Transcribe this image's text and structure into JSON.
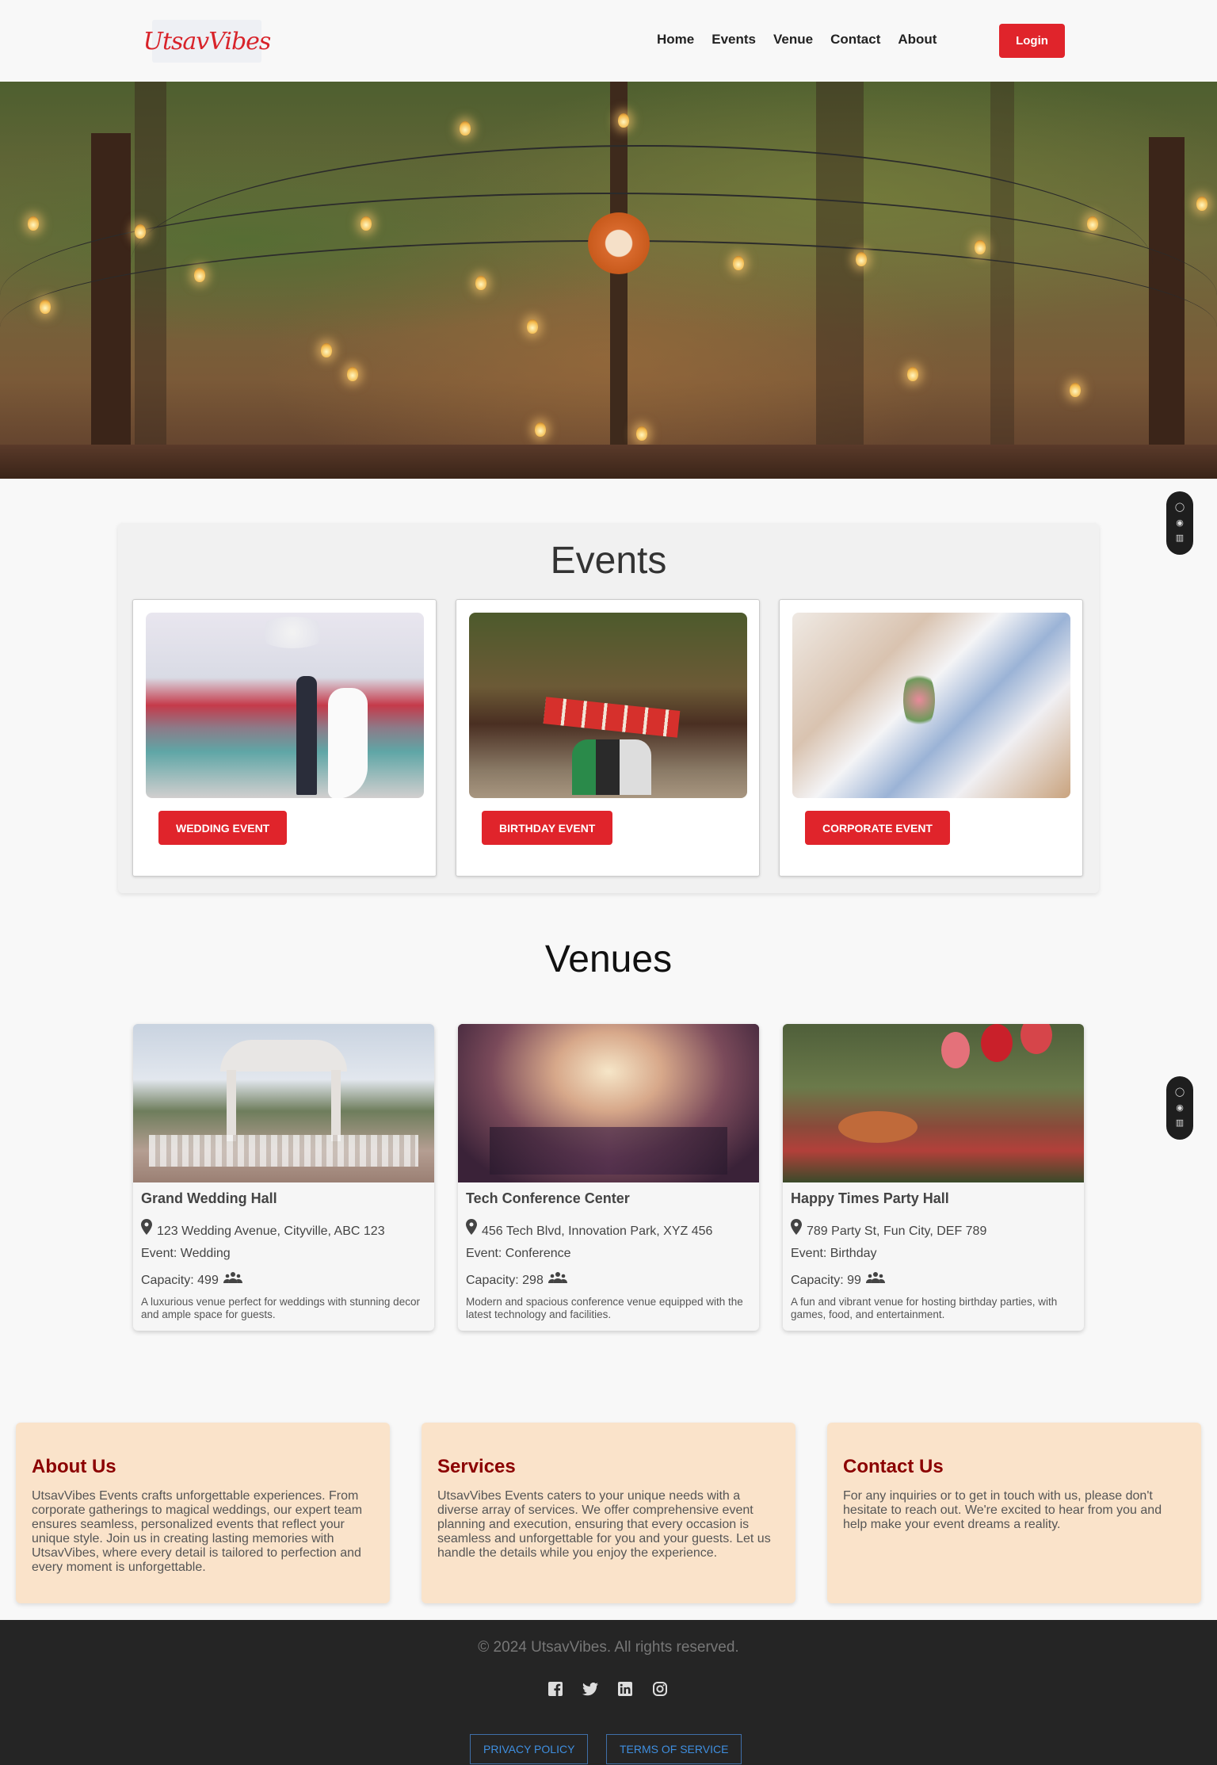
{
  "header": {
    "logo_text": "UtsavVibes",
    "nav": [
      "Home",
      "Events",
      "Venue",
      "Contact",
      "About"
    ],
    "login_label": "Login"
  },
  "events": {
    "title": "Events",
    "cards": [
      {
        "button": "WEDDING EVENT"
      },
      {
        "button": "BIRTHDAY EVENT"
      },
      {
        "button": "CORPORATE EVENT"
      }
    ]
  },
  "venues": {
    "title": "Venues",
    "cards": [
      {
        "name": "Grand Wedding Hall",
        "address": "123 Wedding Avenue, Cityville, ABC 123",
        "event": "Event: Wedding",
        "capacity": "Capacity: 499",
        "description": "A luxurious venue perfect for weddings with stunning decor and ample space for guests."
      },
      {
        "name": "Tech Conference Center",
        "address": "456 Tech Blvd, Innovation Park, XYZ 456",
        "event": "Event: Conference",
        "capacity": "Capacity: 298",
        "description": "Modern and spacious conference venue equipped with the latest technology and facilities."
      },
      {
        "name": "Happy Times Party Hall",
        "address": "789 Party St, Fun City, DEF 789",
        "event": "Event: Birthday",
        "capacity": "Capacity: 99",
        "description": "A fun and vibrant venue for hosting birthday parties, with games, food, and entertainment."
      }
    ]
  },
  "info": [
    {
      "title": "About Us",
      "text": "UtsavVibes Events crafts unforgettable experiences. From corporate gatherings to magical weddings, our expert team ensures seamless, personalized events that reflect your unique style. Join us in creating lasting memories with UtsavVibes, where every detail is tailored to perfection and every moment is unforgettable."
    },
    {
      "title": "Services",
      "text": "UtsavVibes Events caters to your unique needs with a diverse array of services. We offer comprehensive event planning and execution, ensuring that every occasion is seamless and unforgettable for you and your guests. Let us handle the details while you enjoy the experience."
    },
    {
      "title": "Contact Us",
      "text": "For any inquiries or to get in touch with us, please don't hesitate to reach out. We're excited to hear from you and help make your event dreams a reality."
    }
  ],
  "footer": {
    "copyright": "© 2024 UtsavVibes. All rights reserved.",
    "socials": [
      "facebook-icon",
      "twitter-icon",
      "linkedin-icon",
      "instagram-icon"
    ],
    "privacy": "PRIVACY POLICY",
    "terms": "TERMS OF SERVICE"
  },
  "colors": {
    "accent": "#e0242b",
    "info_bg": "#fae3ca",
    "info_title": "#8b0000",
    "footer_bg": "#252525"
  }
}
